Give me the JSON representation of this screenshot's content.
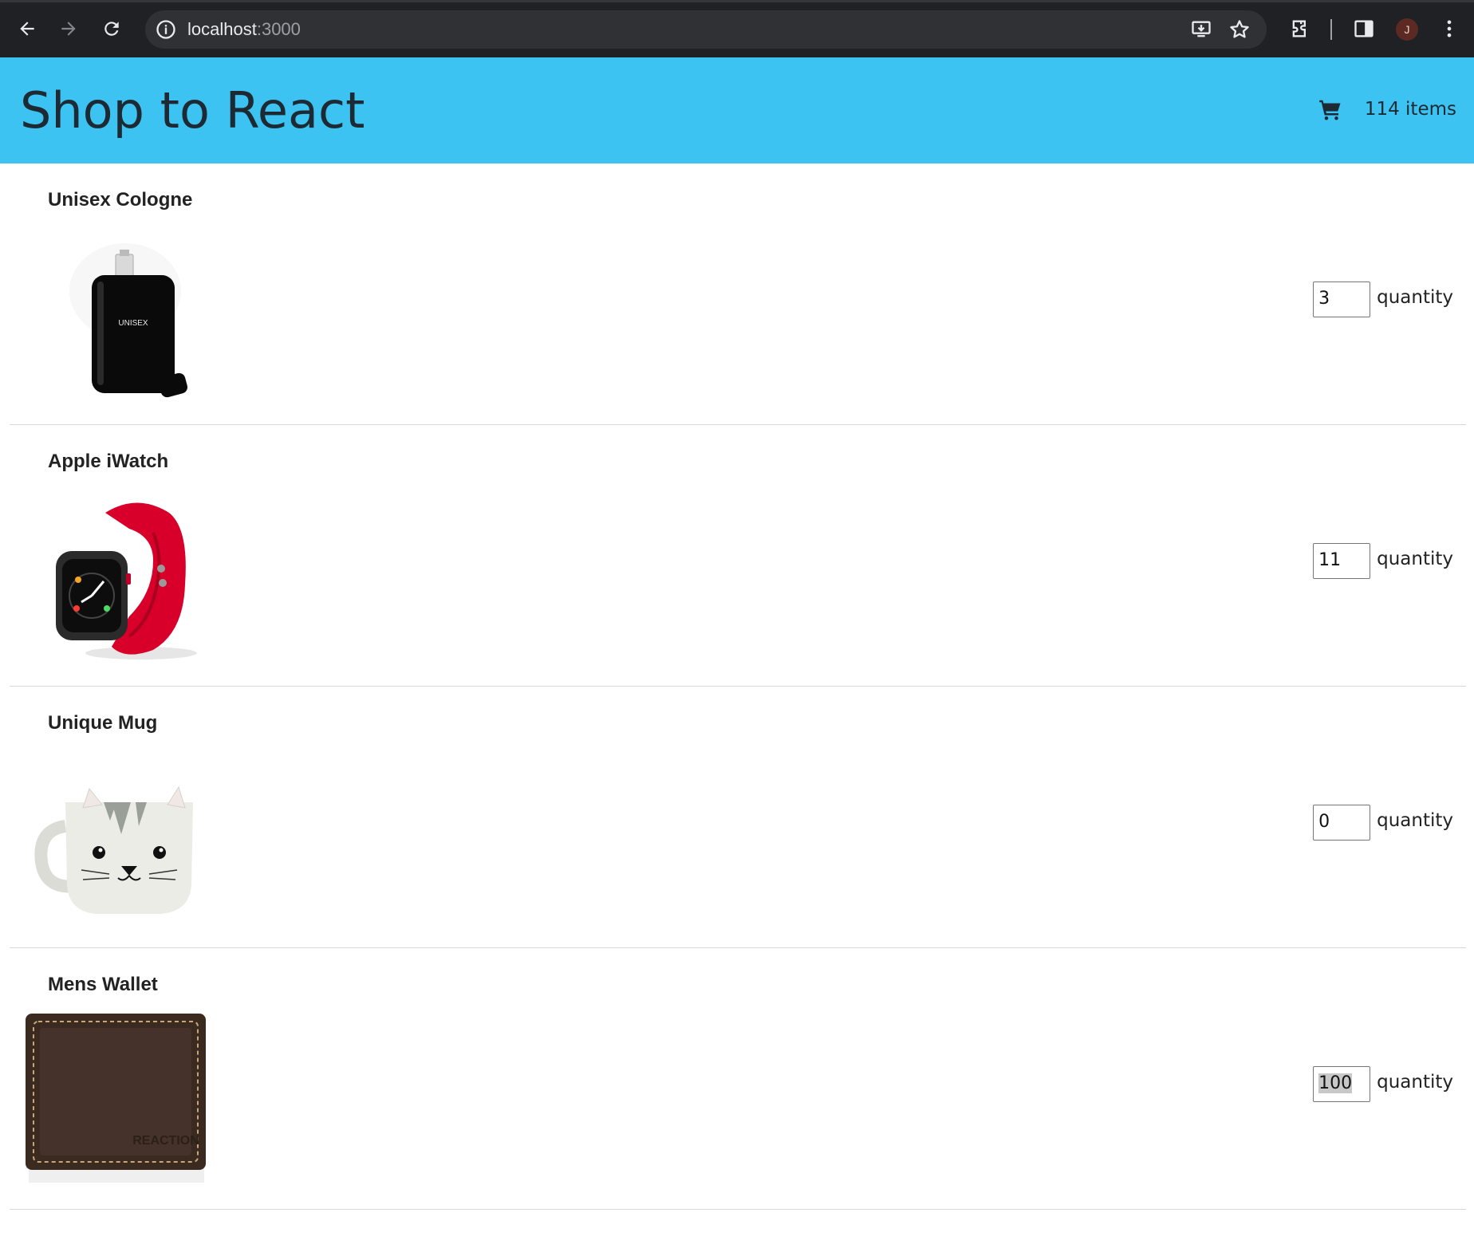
{
  "browser": {
    "url_host": "localhost",
    "url_port": ":3000",
    "profile_initial": "J"
  },
  "header": {
    "title": "Shop to React",
    "cart_count": "114 items"
  },
  "products": [
    {
      "name": "Unisex Cologne",
      "quantity": "3",
      "quantity_label": "quantity",
      "image": "cologne-bottle"
    },
    {
      "name": "Apple iWatch",
      "quantity": "11",
      "quantity_label": "quantity",
      "image": "smartwatch"
    },
    {
      "name": "Unique Mug",
      "quantity": "0",
      "quantity_label": "quantity",
      "image": "cat-mug"
    },
    {
      "name": "Mens Wallet",
      "quantity": "100",
      "quantity_label": "quantity",
      "image": "leather-wallet"
    }
  ],
  "colors": {
    "header_bg": "#3cc3f2",
    "chrome_bg": "#202124"
  }
}
